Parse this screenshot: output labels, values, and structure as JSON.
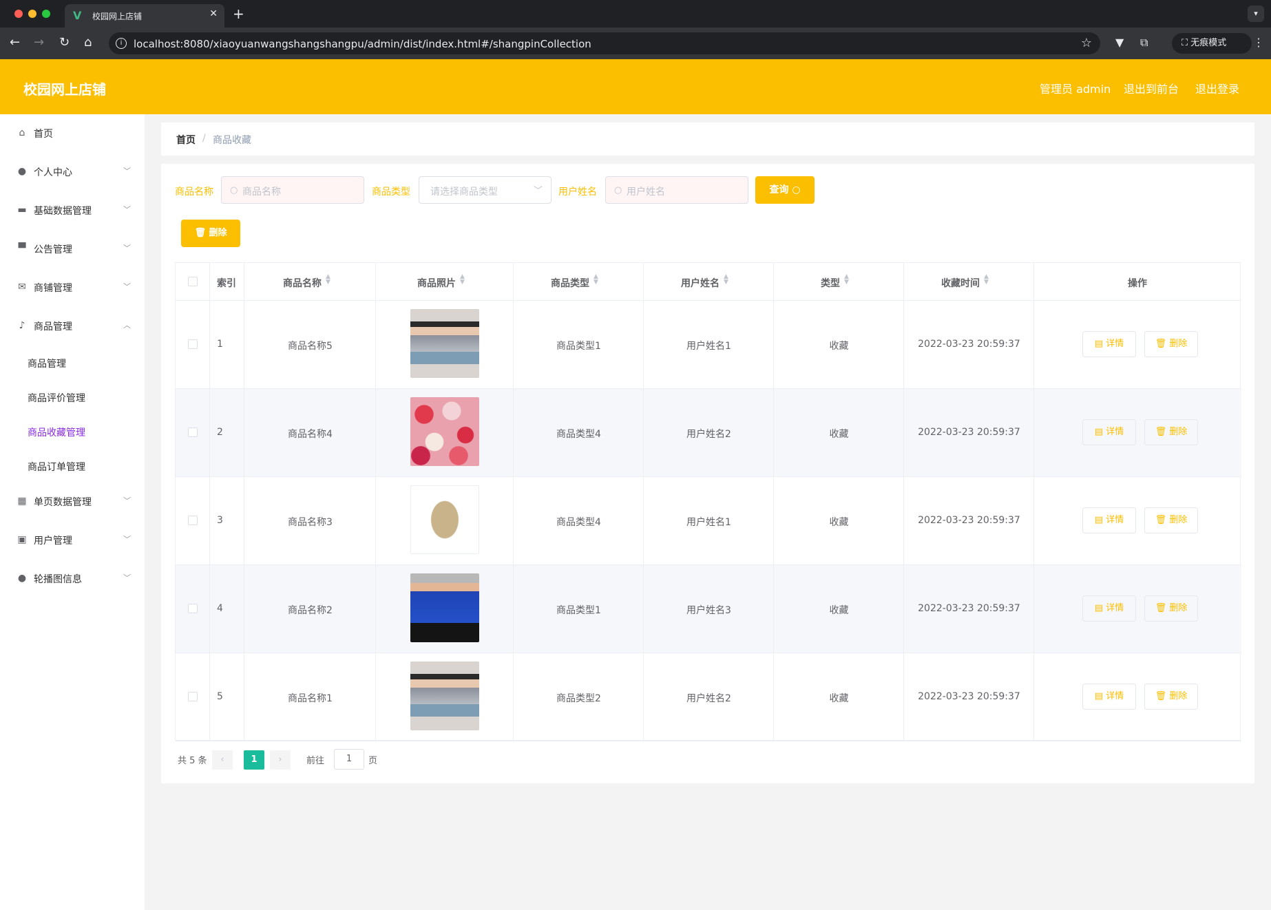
{
  "browser": {
    "tab_title": "校园网上店铺",
    "url": "localhost:8080/xiaoyuanwangshangshangpu/admin/dist/index.html#/shangpinCollection",
    "incognito_label": "无痕模式"
  },
  "header": {
    "title": "校园网上店铺",
    "user_label": "管理员 admin",
    "front_link": "退出到前台",
    "logout_link": "退出登录"
  },
  "sidebar": {
    "items": [
      {
        "label": "首页",
        "icon": "home-icon"
      },
      {
        "label": "个人中心",
        "icon": "user-icon"
      },
      {
        "label": "基础数据管理",
        "icon": "monitor-icon"
      },
      {
        "label": "公告管理",
        "icon": "notice-icon"
      },
      {
        "label": "商铺管理",
        "icon": "mail-icon"
      },
      {
        "label": "商品管理",
        "icon": "microphone-icon"
      },
      {
        "label": "单页数据管理",
        "icon": "grid-icon"
      },
      {
        "label": "用户管理",
        "icon": "clipboard-icon"
      },
      {
        "label": "轮播图信息",
        "icon": "user-icon"
      }
    ],
    "submenu": [
      {
        "label": "商品管理"
      },
      {
        "label": "商品评价管理"
      },
      {
        "label": "商品收藏管理"
      },
      {
        "label": "商品订单管理"
      }
    ]
  },
  "breadcrumb": {
    "home": "首页",
    "current": "商品收藏"
  },
  "filters": {
    "name_label": "商品名称",
    "name_placeholder": "商品名称",
    "type_label": "商品类型",
    "type_placeholder": "请选择商品类型",
    "user_label": "用户姓名",
    "user_placeholder": "用户姓名",
    "query_button": "查询",
    "delete_button": "删除"
  },
  "table": {
    "headers": [
      "索引",
      "商品名称",
      "商品照片",
      "商品类型",
      "用户姓名",
      "类型",
      "收藏时间",
      "操作"
    ],
    "rows": [
      {
        "index": "1",
        "name": "商品名称5",
        "type": "商品类型1",
        "user": "用户姓名1",
        "kind": "收藏",
        "time": "2022-03-23 20:59:37",
        "photo": "woman-plaid-top"
      },
      {
        "index": "2",
        "name": "商品名称4",
        "type": "商品类型4",
        "user": "用户姓名2",
        "kind": "收藏",
        "time": "2022-03-23 20:59:37",
        "photo": "roses"
      },
      {
        "index": "3",
        "name": "商品名称3",
        "type": "商品类型4",
        "user": "用户姓名1",
        "kind": "收藏",
        "time": "2022-03-23 20:59:37",
        "photo": "phone"
      },
      {
        "index": "4",
        "name": "商品名称2",
        "type": "商品类型1",
        "user": "用户姓名3",
        "kind": "收藏",
        "time": "2022-03-23 20:59:37",
        "photo": "man-blue-sweater"
      },
      {
        "index": "5",
        "name": "商品名称1",
        "type": "商品类型2",
        "user": "用户姓名2",
        "kind": "收藏",
        "time": "2022-03-23 20:59:37",
        "photo": "woman-plaid-top"
      }
    ],
    "detail_button": "详情",
    "delete_button": "删除"
  },
  "pagination": {
    "total_text": "共 5 条",
    "current_page": "1",
    "goto_prefix": "前往",
    "goto_value": "1",
    "goto_suffix": "页"
  },
  "colors": {
    "accent": "#fbbf00",
    "active_menu": "#8a2be2",
    "page_active": "#1abc9c"
  }
}
